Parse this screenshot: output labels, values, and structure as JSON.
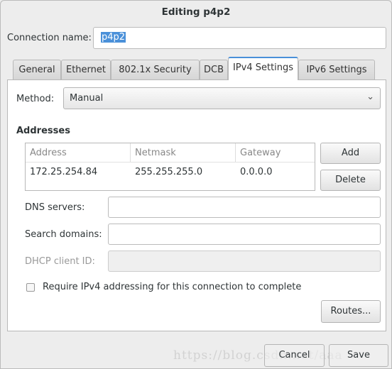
{
  "window": {
    "title": "Editing p4p2"
  },
  "connection": {
    "label": "Connection name:",
    "value": "p4p2"
  },
  "tabs": [
    {
      "label": "General"
    },
    {
      "label": "Ethernet"
    },
    {
      "label": "802.1x Security"
    },
    {
      "label": "DCB"
    },
    {
      "label": "IPv4 Settings",
      "active": true
    },
    {
      "label": "IPv6 Settings"
    }
  ],
  "ipv4": {
    "method_label": "Method:",
    "method_value": "Manual",
    "addresses_heading": "Addresses",
    "columns": [
      "Address",
      "Netmask",
      "Gateway"
    ],
    "rows": [
      [
        "172.25.254.84",
        "255.255.255.0",
        "0.0.0.0"
      ]
    ],
    "add_label": "Add",
    "delete_label": "Delete",
    "dns_label": "DNS servers:",
    "dns_value": "",
    "search_label": "Search domains:",
    "search_value": "",
    "dhcp_label": "DHCP client ID:",
    "dhcp_value": "",
    "require_label": "Require IPv4 addressing for this connection to complete",
    "require_checked": false,
    "routes_label": "Routes..."
  },
  "footer": {
    "cancel_label": "Cancel",
    "save_label": "Save"
  },
  "watermark": "https://blog.csdn.net/aaa"
}
